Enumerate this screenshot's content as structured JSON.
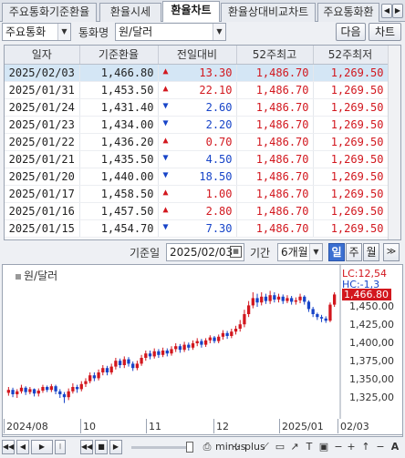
{
  "tabs": [
    "주요통화기준환율",
    "환율시세",
    "환율차트",
    "환율상대비교차트",
    "주요통화환"
  ],
  "toolbar": {
    "currency_group": "주요통화",
    "currency_name_label": "통화명",
    "currency_pair": "원/달러",
    "next_button": "다음",
    "chart_button": "차트"
  },
  "table": {
    "headers": [
      "일자",
      "기준환율",
      "전일대비",
      "52주최고",
      "52주최저"
    ],
    "rows": [
      {
        "date": "2025/02/03",
        "rate": "1,466.80",
        "dir": "up",
        "change": "13.30",
        "high": "1,486.70",
        "low": "1,269.50"
      },
      {
        "date": "2025/01/31",
        "rate": "1,453.50",
        "dir": "up",
        "change": "22.10",
        "high": "1,486.70",
        "low": "1,269.50"
      },
      {
        "date": "2025/01/24",
        "rate": "1,431.40",
        "dir": "down",
        "change": "2.60",
        "high": "1,486.70",
        "low": "1,269.50"
      },
      {
        "date": "2025/01/23",
        "rate": "1,434.00",
        "dir": "down",
        "change": "2.20",
        "high": "1,486.70",
        "low": "1,269.50"
      },
      {
        "date": "2025/01/22",
        "rate": "1,436.20",
        "dir": "up",
        "change": "0.70",
        "high": "1,486.70",
        "low": "1,269.50"
      },
      {
        "date": "2025/01/21",
        "rate": "1,435.50",
        "dir": "down",
        "change": "4.50",
        "high": "1,486.70",
        "low": "1,269.50"
      },
      {
        "date": "2025/01/20",
        "rate": "1,440.00",
        "dir": "down",
        "change": "18.50",
        "high": "1,486.70",
        "low": "1,269.50"
      },
      {
        "date": "2025/01/17",
        "rate": "1,458.50",
        "dir": "up",
        "change": "1.00",
        "high": "1,486.70",
        "low": "1,269.50"
      },
      {
        "date": "2025/01/16",
        "rate": "1,457.50",
        "dir": "up",
        "change": "2.80",
        "high": "1,486.70",
        "low": "1,269.50"
      },
      {
        "date": "2025/01/15",
        "rate": "1,454.70",
        "dir": "down",
        "change": "7.30",
        "high": "1,486.70",
        "low": "1,269.50"
      }
    ]
  },
  "chart_controls": {
    "base_date_label": "기준일",
    "base_date": "2025/02/03",
    "period_label": "기간",
    "period_value": "6개월",
    "period_buttons": [
      "일",
      "주",
      "월"
    ],
    "active_period": "일",
    "expand_icon": "double-chevron-right"
  },
  "chart_data": {
    "type": "candlestick",
    "legend": "원/달러",
    "y_ticks": [
      "1,450.00",
      "1,425,00",
      "1,400,00",
      "1,375,00",
      "1,350,00",
      "1,325,00"
    ],
    "x_ticks": [
      "2024/08",
      "10",
      "11",
      "12",
      "2025/01",
      "02/03"
    ],
    "ylim": [
      1300,
      1490
    ],
    "current_price_tag": "1,466.80",
    "lc_label": "LC:12,54",
    "hc_label": "HC:-1,3",
    "up_color": "#d2171e",
    "down_color": "#1744c8",
    "candles": [
      {
        "o": 1332,
        "c": 1336,
        "h": 1340,
        "l": 1328
      },
      {
        "o": 1336,
        "c": 1330,
        "h": 1339,
        "l": 1326
      },
      {
        "o": 1330,
        "c": 1334,
        "h": 1337,
        "l": 1325
      },
      {
        "o": 1334,
        "c": 1339,
        "h": 1343,
        "l": 1331
      },
      {
        "o": 1339,
        "c": 1333,
        "h": 1341,
        "l": 1329
      },
      {
        "o": 1333,
        "c": 1337,
        "h": 1340,
        "l": 1330
      },
      {
        "o": 1337,
        "c": 1331,
        "h": 1338,
        "l": 1327
      },
      {
        "o": 1331,
        "c": 1335,
        "h": 1338,
        "l": 1327
      },
      {
        "o": 1335,
        "c": 1340,
        "h": 1343,
        "l": 1332
      },
      {
        "o": 1340,
        "c": 1336,
        "h": 1342,
        "l": 1333
      },
      {
        "o": 1336,
        "c": 1341,
        "h": 1344,
        "l": 1333
      },
      {
        "o": 1341,
        "c": 1334,
        "h": 1343,
        "l": 1330
      },
      {
        "o": 1334,
        "c": 1330,
        "h": 1337,
        "l": 1325
      },
      {
        "o": 1330,
        "c": 1326,
        "h": 1333,
        "l": 1318
      },
      {
        "o": 1326,
        "c": 1334,
        "h": 1338,
        "l": 1322
      },
      {
        "o": 1334,
        "c": 1340,
        "h": 1345,
        "l": 1331
      },
      {
        "o": 1340,
        "c": 1337,
        "h": 1343,
        "l": 1332
      },
      {
        "o": 1337,
        "c": 1344,
        "h": 1348,
        "l": 1334
      },
      {
        "o": 1344,
        "c": 1348,
        "h": 1352,
        "l": 1340
      },
      {
        "o": 1348,
        "c": 1356,
        "h": 1360,
        "l": 1345
      },
      {
        "o": 1356,
        "c": 1352,
        "h": 1360,
        "l": 1348
      },
      {
        "o": 1352,
        "c": 1360,
        "h": 1364,
        "l": 1349
      },
      {
        "o": 1360,
        "c": 1366,
        "h": 1370,
        "l": 1356
      },
      {
        "o": 1366,
        "c": 1360,
        "h": 1369,
        "l": 1356
      },
      {
        "o": 1360,
        "c": 1368,
        "h": 1372,
        "l": 1357
      },
      {
        "o": 1368,
        "c": 1376,
        "h": 1380,
        "l": 1364
      },
      {
        "o": 1376,
        "c": 1370,
        "h": 1379,
        "l": 1366
      },
      {
        "o": 1370,
        "c": 1378,
        "h": 1382,
        "l": 1366
      },
      {
        "o": 1378,
        "c": 1372,
        "h": 1381,
        "l": 1368
      },
      {
        "o": 1372,
        "c": 1366,
        "h": 1375,
        "l": 1362
      },
      {
        "o": 1366,
        "c": 1372,
        "h": 1376,
        "l": 1363
      },
      {
        "o": 1372,
        "c": 1380,
        "h": 1384,
        "l": 1369
      },
      {
        "o": 1380,
        "c": 1386,
        "h": 1390,
        "l": 1376
      },
      {
        "o": 1386,
        "c": 1382,
        "h": 1390,
        "l": 1378
      },
      {
        "o": 1382,
        "c": 1389,
        "h": 1393,
        "l": 1379
      },
      {
        "o": 1389,
        "c": 1384,
        "h": 1392,
        "l": 1380
      },
      {
        "o": 1384,
        "c": 1390,
        "h": 1394,
        "l": 1381
      },
      {
        "o": 1390,
        "c": 1386,
        "h": 1393,
        "l": 1382
      },
      {
        "o": 1386,
        "c": 1392,
        "h": 1396,
        "l": 1383
      },
      {
        "o": 1392,
        "c": 1396,
        "h": 1400,
        "l": 1388
      },
      {
        "o": 1396,
        "c": 1391,
        "h": 1399,
        "l": 1387
      },
      {
        "o": 1391,
        "c": 1398,
        "h": 1402,
        "l": 1388
      },
      {
        "o": 1398,
        "c": 1394,
        "h": 1401,
        "l": 1390
      },
      {
        "o": 1394,
        "c": 1400,
        "h": 1404,
        "l": 1391
      },
      {
        "o": 1400,
        "c": 1403,
        "h": 1407,
        "l": 1396
      },
      {
        "o": 1403,
        "c": 1398,
        "h": 1406,
        "l": 1394
      },
      {
        "o": 1398,
        "c": 1404,
        "h": 1407,
        "l": 1395
      },
      {
        "o": 1404,
        "c": 1408,
        "h": 1411,
        "l": 1400
      },
      {
        "o": 1408,
        "c": 1403,
        "h": 1410,
        "l": 1400
      },
      {
        "o": 1403,
        "c": 1409,
        "h": 1412,
        "l": 1400
      },
      {
        "o": 1409,
        "c": 1414,
        "h": 1418,
        "l": 1405
      },
      {
        "o": 1414,
        "c": 1410,
        "h": 1417,
        "l": 1406
      },
      {
        "o": 1410,
        "c": 1416,
        "h": 1420,
        "l": 1407
      },
      {
        "o": 1416,
        "c": 1420,
        "h": 1424,
        "l": 1412
      },
      {
        "o": 1420,
        "c": 1426,
        "h": 1432,
        "l": 1416
      },
      {
        "o": 1426,
        "c": 1440,
        "h": 1446,
        "l": 1422
      },
      {
        "o": 1440,
        "c": 1452,
        "h": 1458,
        "l": 1436
      },
      {
        "o": 1452,
        "c": 1462,
        "h": 1470,
        "l": 1448
      },
      {
        "o": 1462,
        "c": 1456,
        "h": 1468,
        "l": 1450
      },
      {
        "o": 1456,
        "c": 1464,
        "h": 1470,
        "l": 1452
      },
      {
        "o": 1464,
        "c": 1458,
        "h": 1468,
        "l": 1454
      },
      {
        "o": 1458,
        "c": 1466,
        "h": 1472,
        "l": 1454
      },
      {
        "o": 1466,
        "c": 1460,
        "h": 1470,
        "l": 1456
      },
      {
        "o": 1460,
        "c": 1464,
        "h": 1468,
        "l": 1456
      },
      {
        "o": 1464,
        "c": 1458,
        "h": 1467,
        "l": 1454
      },
      {
        "o": 1458,
        "c": 1462,
        "h": 1466,
        "l": 1455
      },
      {
        "o": 1462,
        "c": 1457,
        "h": 1465,
        "l": 1453
      },
      {
        "o": 1457,
        "c": 1459,
        "h": 1463,
        "l": 1453
      },
      {
        "o": 1459,
        "c": 1464,
        "h": 1468,
        "l": 1455
      },
      {
        "o": 1464,
        "c": 1457,
        "h": 1466,
        "l": 1453
      },
      {
        "o": 1457,
        "c": 1447,
        "h": 1459,
        "l": 1443
      },
      {
        "o": 1447,
        "c": 1440,
        "h": 1450,
        "l": 1436
      },
      {
        "o": 1440,
        "c": 1436,
        "h": 1442,
        "l": 1432
      },
      {
        "o": 1436,
        "c": 1434,
        "h": 1439,
        "l": 1429
      },
      {
        "o": 1434,
        "c": 1431,
        "h": 1437,
        "l": 1428
      },
      {
        "o": 1431,
        "c": 1453,
        "h": 1456,
        "l": 1429
      },
      {
        "o": 1453,
        "c": 1467,
        "h": 1470,
        "l": 1450
      }
    ]
  },
  "navbar": {
    "zoom_out_icon": "minus",
    "zoom_in_icon": "plus",
    "font_icon": "A"
  }
}
